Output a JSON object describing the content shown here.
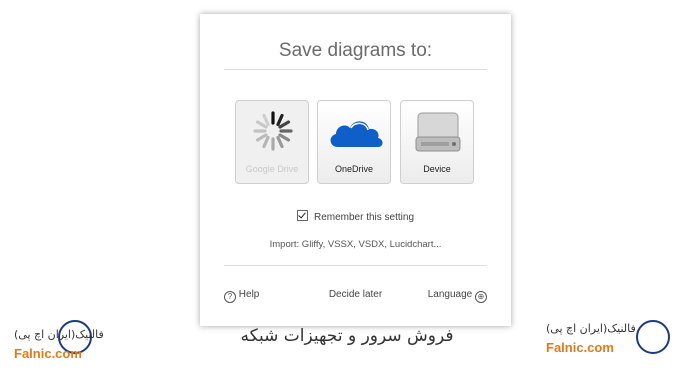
{
  "dialog": {
    "title": "Save diagrams to:",
    "options": [
      {
        "label": "Google Drive",
        "icon": "loading-spinner-icon",
        "state": "disabled"
      },
      {
        "label": "OneDrive",
        "icon": "onedrive-cloud-icon"
      },
      {
        "label": "Device",
        "icon": "hard-drive-icon"
      }
    ],
    "remember_label": "Remember this setting",
    "remember_checked": true,
    "import_text": "Import: Gliffy, VSSX, VSDX, Lucidchart...",
    "footer": {
      "help": "Help",
      "decide_later": "Decide later",
      "language": "Language"
    }
  },
  "branding": {
    "caption": "فروش سرور و تجهیزات شبکه",
    "left_fa": "فالنیک(ایران اچ پی)",
    "left_en": "Falnic.com",
    "right_fa": "فالنیک(ایران اچ پی)",
    "right_en": "Falnic.com"
  },
  "colors": {
    "onedrive_blue": "#0e5fc7",
    "brand_orange": "#e07b1a",
    "seal_blue": "#1d3b7c"
  }
}
